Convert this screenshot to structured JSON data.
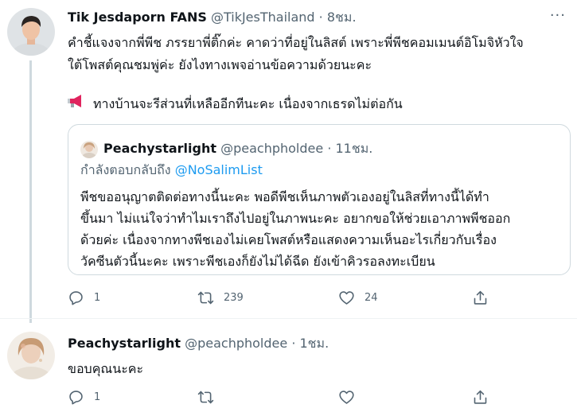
{
  "tweet1": {
    "name": "Tik Jesdaporn FANS",
    "handle": "@TikJesThailand",
    "dot": "·",
    "time": "8ชม.",
    "text_line1": "คำชี้แจงจากพี่พีช ภรรยาพี่ติ๊กค่ะ คาดว่าที่อยู่ในลิสต์ เพราะพี่พีชคอมเมนต์อิโมจิหัวใจ",
    "text_line2": "ใต้โพสต์คุณชมพู่ค่ะ ยังไงทางเพจอ่านข้อความด้วยนะคะ",
    "text_line3": "ทางบ้านจะรีส่วนที่เหลืออีกทีนะคะ เนื่องจากเธรดไม่ต่อกัน",
    "megaphone_icon": "megaphone-icon",
    "more_label": "···",
    "quote": {
      "name": "Peachystarlight",
      "handle": "@peachpholdee",
      "dot": "·",
      "time": "11ชม.",
      "reply_prefix": "กำลังตอบกลับถึง",
      "reply_to": "@NoSalimList",
      "lines": [
        "พีชขออนุญาตติดต่อทางนี้นะคะ พอดีพีชเห็นภาพตัวเองอยู่ในลิสที่ทางนี้ได้ทำ",
        "ขึ้นมา ไม่แน่ใจว่าทำไมเราถึงไปอยู่ในภาพนะคะ อยากขอให้ช่วยเอาภาพพีชออก",
        "ด้วยค่ะ เนื่องจากทางพีชเองไม่เคยโพสต์หรือแสดงความเห็นอะไรเกี่ยวกับเรื่อง",
        "วัคซีนตัวนี้นะคะ เพราะพีชเองก็ยังไม่ได้ฉีด ยังเข้าคิวรอลงทะเบียน"
      ]
    },
    "replies": "1",
    "retweets": "239",
    "likes": "24"
  },
  "tweet2": {
    "name": "Peachystarlight",
    "handle": "@peachpholdee",
    "dot": "·",
    "time": "1ชม.",
    "text": "ขอบคุณนะคะ",
    "replies": "1",
    "retweets": "",
    "likes": ""
  },
  "colors": {
    "text": "#0f1419",
    "secondary": "#536471",
    "link": "#1d9bf0",
    "border": "#cfd9de",
    "megaphone": "#e0245e"
  }
}
